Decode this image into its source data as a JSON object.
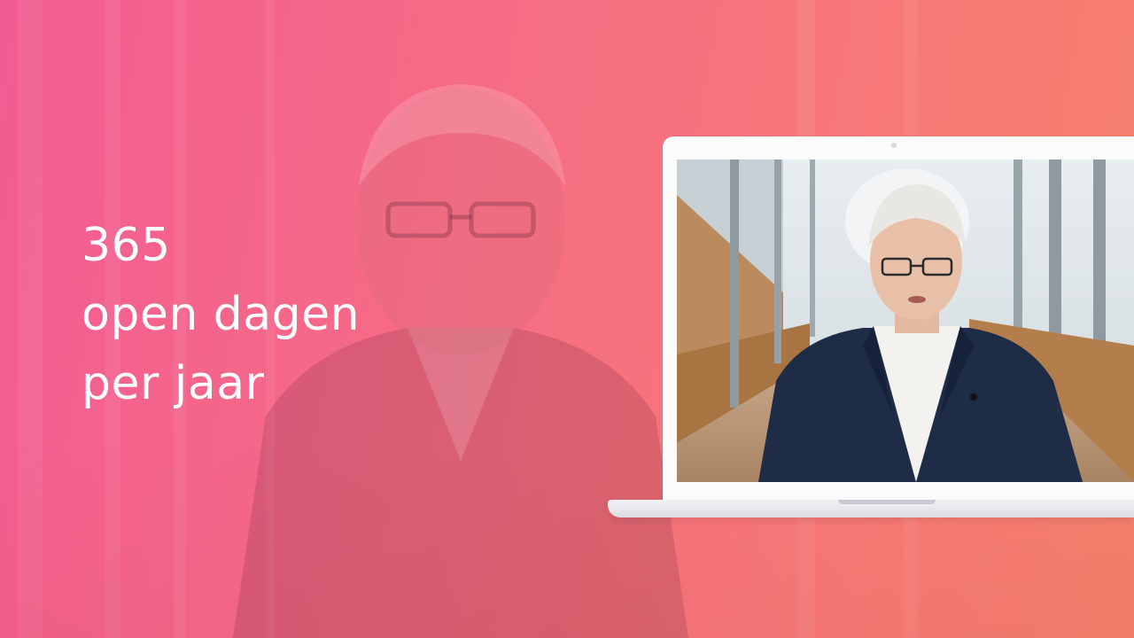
{
  "headline": {
    "line1": "365",
    "line2": "open dagen",
    "line3": "per jaar"
  },
  "colors": {
    "overlay_start": "#f25c92",
    "overlay_end": "#f5806a",
    "text": "#ffffff",
    "laptop_body": "#fbfbfc"
  },
  "video": {
    "subject": "man-in-navy-blazer-speaking",
    "setting": "glass-walkway-hall"
  }
}
